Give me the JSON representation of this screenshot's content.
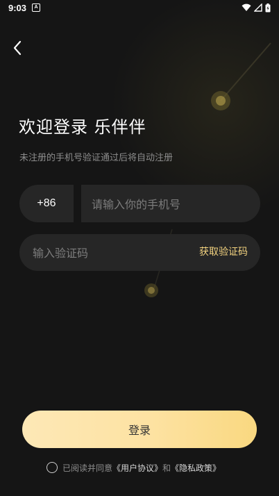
{
  "status_bar": {
    "time": "9:03",
    "ime_label": "A"
  },
  "header": {
    "title": "欢迎登录 乐伴伴",
    "subtitle": "未注册的手机号验证通过后将自动注册"
  },
  "phone": {
    "country_code": "+86",
    "placeholder": "请输入你的手机号",
    "value": ""
  },
  "code": {
    "placeholder": "输入验证码",
    "value": "",
    "get_code_label": "获取验证码"
  },
  "login": {
    "label": "登录"
  },
  "agreement": {
    "prefix": "已阅读并同意",
    "user_agreement": "《用户协议》",
    "conjunction": "和",
    "privacy_policy": "《隐私政策》",
    "checked": false
  },
  "colors": {
    "background": "#151515",
    "field": "#262626",
    "accent": "#f2d27f",
    "button_gradient_start": "#fde8b6",
    "button_gradient_end": "#f9d880"
  }
}
